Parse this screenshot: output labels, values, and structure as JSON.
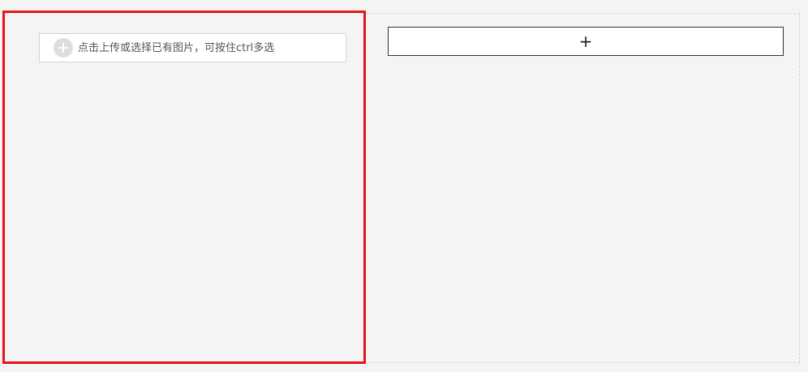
{
  "left_panel": {
    "upload_button_label": "点击上传或选择已有图片，可按住ctrl多选",
    "upload_icon": "plus-circle-icon"
  },
  "right_panel": {
    "add_button_symbol": "+",
    "add_icon": "plus-icon"
  },
  "colors": {
    "background": "#f4f4f4",
    "highlight_border": "#e81515",
    "dashed_border": "#d4d4d4",
    "button_border_left": "#d2d2d2",
    "button_border_right": "#333333",
    "label_text": "#555555"
  }
}
